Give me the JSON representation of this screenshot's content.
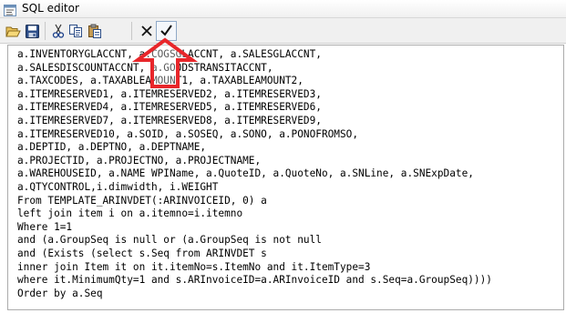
{
  "window": {
    "title": "SQL editor",
    "app_icon": "sql-editor-icon"
  },
  "toolbar": {
    "buttons": [
      {
        "name": "open-folder-icon"
      },
      {
        "name": "save-icon"
      },
      {
        "name": "cut-icon"
      },
      {
        "name": "copy-icon"
      },
      {
        "name": "paste-icon"
      },
      {
        "name": "close-icon"
      },
      {
        "name": "checkmark-icon"
      }
    ]
  },
  "annotation": {
    "color": "#e8262a",
    "shape": "arrow-pointing-up"
  },
  "editor": {
    "lines": [
      "a.INVENTORYGLACCNT, a.COGSGLACCNT, a.SALESGLACCNT,",
      "a.SALESDISCOUNTACCNT, a.GOODSTRANSITACCNT,",
      "a.TAXCODES, a.TAXABLEAMOUNT1, a.TAXABLEAMOUNT2,",
      "a.ITEMRESERVED1, a.ITEMRESERVED2, a.ITEMRESERVED3,",
      "a.ITEMRESERVED4, a.ITEMRESERVED5, a.ITEMRESERVED6,",
      "a.ITEMRESERVED7, a.ITEMRESERVED8, a.ITEMRESERVED9,",
      "a.ITEMRESERVED10, a.SOID, a.SOSEQ, a.SONO, a.PONOFROMSO,",
      "a.DEPTID, a.DEPTNO, a.DEPTNAME,",
      "a.PROJECTID, a.PROJECTNO, a.PROJECTNAME,",
      "a.WAREHOUSEID, a.NAME WPIName, a.QuoteID, a.QuoteNo, a.SNLine, a.SNExpDate,",
      "a.QTYCONTROL,i.dimwidth, i.WEIGHT",
      "From TEMPLATE_ARINVDET(:ARINVOICEID, 0) a",
      "left join item i on a.itemno=i.itemno",
      "Where 1=1",
      "and (a.GroupSeq is null or (a.GroupSeq is not null",
      "and (Exists (select s.Seq from ARINVDET s",
      "inner join Item it on it.itemNo=s.ItemNo and it.ItemType=3",
      "where it.MinimumQty=1 and s.ARInvoiceID=a.ARInvoiceID and s.Seq=a.GroupSeq))))",
      "Order by a.Seq"
    ]
  }
}
